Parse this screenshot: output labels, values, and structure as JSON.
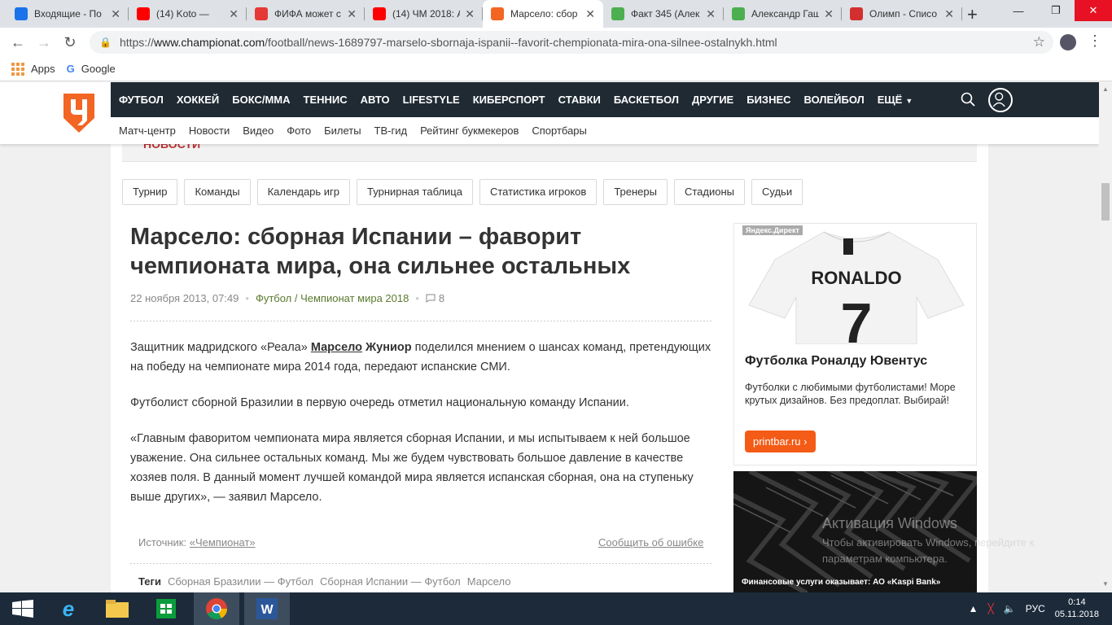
{
  "browser": {
    "tabs": [
      {
        "title": "Входящие - По",
        "favicon": "mail-icon",
        "color": "#1a73e8"
      },
      {
        "title": "(14) Koto — ",
        "favicon": "youtube-icon",
        "color": "#ff0000"
      },
      {
        "title": "ФИФА может с",
        "favicon": "g-icon",
        "color": "#e53935"
      },
      {
        "title": "(14) ЧМ 2018: А",
        "favicon": "youtube-icon",
        "color": "#ff0000"
      },
      {
        "title": "Марсело: сбор",
        "favicon": "championat-icon",
        "color": "#f26522",
        "active": true
      },
      {
        "title": "Факт 345 (Алек",
        "favicon": "doc-icon",
        "color": "#4caf50"
      },
      {
        "title": "Александр Гаш",
        "favicon": "doc-icon",
        "color": "#4caf50"
      },
      {
        "title": "Олимп - Списо",
        "favicon": "olimp-icon",
        "color": "#d32f2f"
      }
    ],
    "url_prefix": "https://",
    "url_domain": "www.championat.com",
    "url_path": "/football/news-1689797-marselo-sbornaja-ispanii--favorit-chempionata-mira-ona-silnee-ostalnykh.html",
    "bookmarks": [
      "Apps",
      "Google"
    ]
  },
  "site": {
    "main_nav": [
      "ФУТБОЛ",
      "ХОККЕЙ",
      "БОКС/ММА",
      "ТЕННИС",
      "АВТО",
      "LIFESTYLE",
      "КИБЕРСПОРТ",
      "СТАВКИ",
      "БАСКЕТБОЛ",
      "ДРУГИЕ",
      "БИЗНЕС",
      "ВОЛЕЙБОЛ",
      "ЕЩЁ"
    ],
    "sub_nav": [
      "Матч-центр",
      "Новости",
      "Видео",
      "Фото",
      "Билеты",
      "ТВ-гид",
      "Рейтинг букмекеров",
      "Спортбары"
    ],
    "banner_text": "НОВОСТИ",
    "filters": [
      "Турнир",
      "Команды",
      "Календарь игр",
      "Турнирная таблица",
      "Статистика игроков",
      "Тренеры",
      "Стадионы",
      "Судьи"
    ],
    "accent": "#f26522",
    "dark": "#1f2a33"
  },
  "article": {
    "title": "Марсело: сборная Испании – фаворит чемпионата мира, она сильнее остальных",
    "date": "22 ноября 2013, 07:49",
    "category": "Футбол / Чемпионат мира 2018",
    "comments": "8",
    "p1_a": "Защитник мадридского «Реала» ",
    "p1_link": "Марсело",
    "p1_b": " Жуниор",
    "p1_c": " поделился мнением о шансах команд, претендующих на победу на чемпионате мира 2014 года, передают испанские СМИ.",
    "p2": "Футболист сборной Бразилии в первую очередь отметил национальную команду Испании.",
    "p3": "«Главным фаворитом чемпионата мира является сборная Испании, и мы испытываем к ней большое уважение. Она сильнее остальных команд. Мы же будем чувствовать большое давление в качестве хозяев поля. В данный момент лучшей командой мира является испанская сборная, она на ступеньку выше других», — заявил Марсело.",
    "source_label": "Источник:",
    "source": "«Чемпионат»",
    "report": "Сообщить об ошибке",
    "tags_label": "Теги",
    "tags": [
      "Сборная Бразилии — Футбол",
      "Сборная Испании — Футбол",
      "Марсело"
    ]
  },
  "ads": {
    "label": "Яндекс.Директ",
    "shirt_name": "RONALDO",
    "shirt_number": "7",
    "title": "Футболка Роналду Ювентус",
    "text": "Футболки с любимыми футболистами! Море крутых дизайнов. Без предоплат. Выбирай!",
    "button": "printbar.ru",
    "ad2_caption": "Финансовые услуги оказывает: АО «Kaspi Bank»"
  },
  "os": {
    "watermark_title": "Активация Windows",
    "watermark_text_1": "Чтобы активировать Windows, перейдите к",
    "watermark_text_2": "параметрам компьютера.",
    "lang": "РУС",
    "time": "0:14",
    "date": "05.11.2018"
  }
}
